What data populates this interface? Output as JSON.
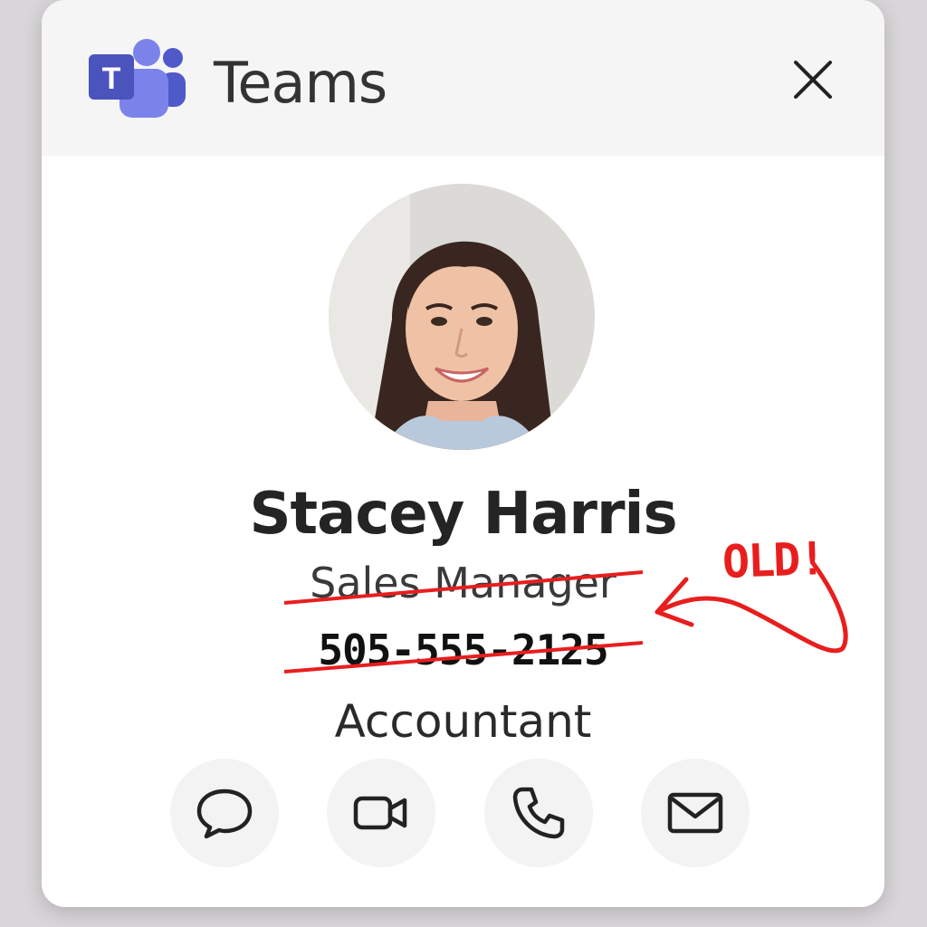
{
  "app": {
    "title": "Teams",
    "brand_color": "#5b5fc7",
    "logo_letter": "T"
  },
  "profile": {
    "name": "Stacey Harris",
    "old_title": "Sales Manager",
    "old_phone": "505-555-2125",
    "new_title": "Accountant"
  },
  "annotation": {
    "text": "OLD!",
    "color": "#e81e1e"
  },
  "actions": [
    {
      "icon": "chat-icon"
    },
    {
      "icon": "video-call-icon"
    },
    {
      "icon": "phone-icon"
    },
    {
      "icon": "mail-icon"
    }
  ]
}
